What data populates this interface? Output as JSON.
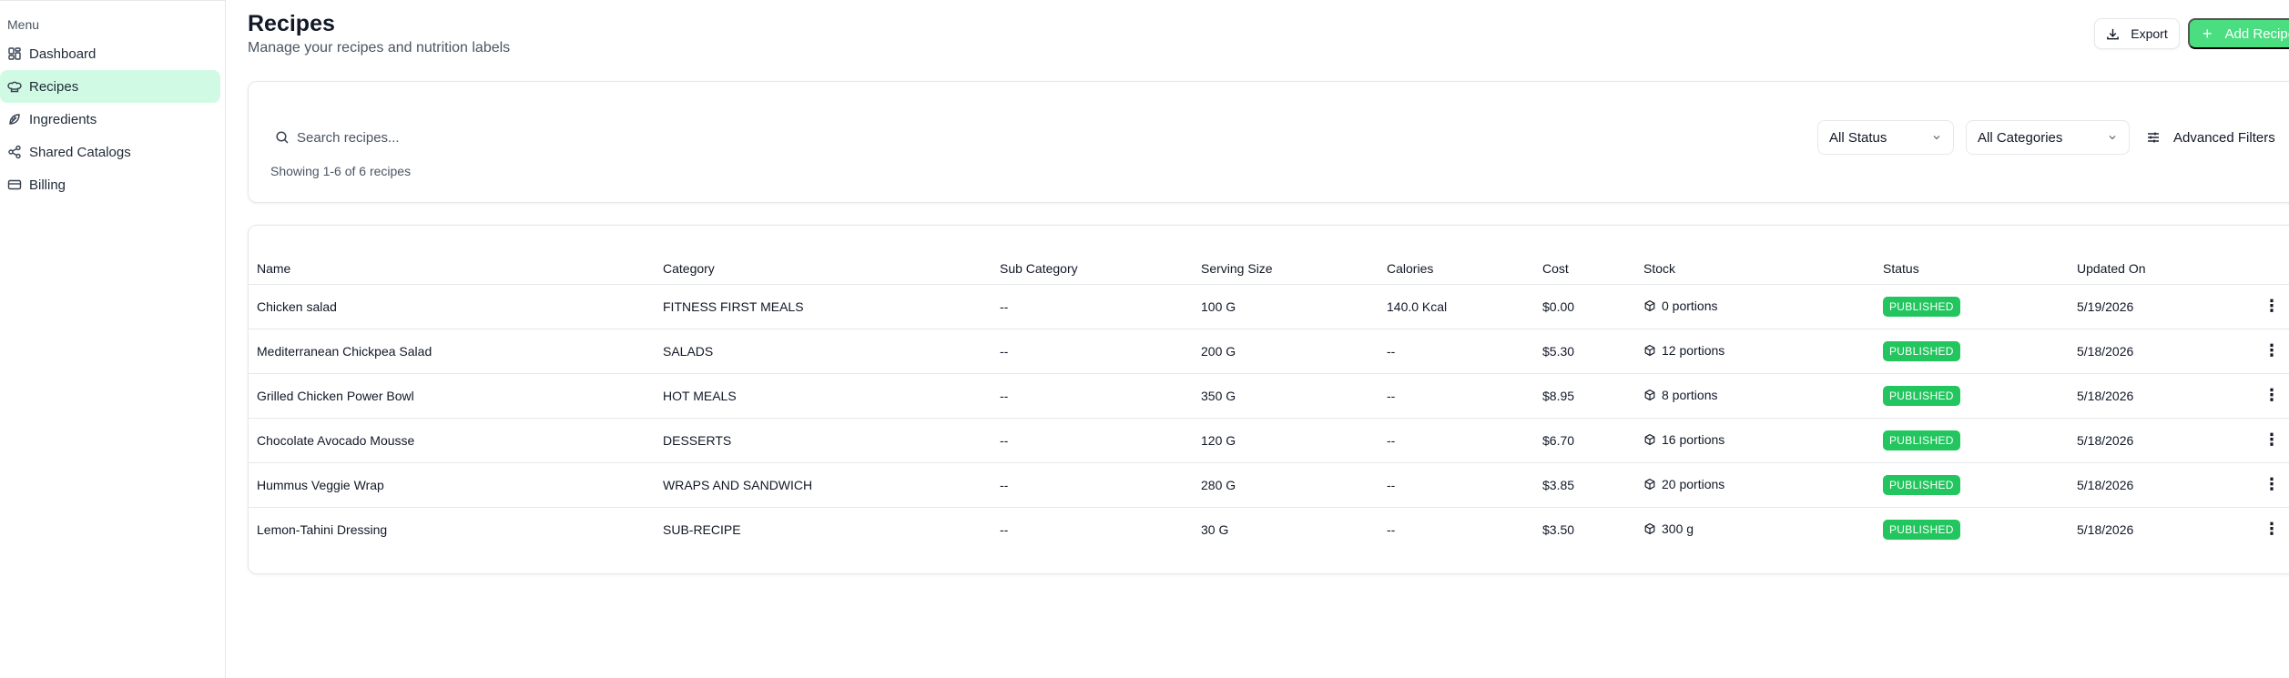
{
  "sidebar": {
    "menu_label": "Menu",
    "items": [
      {
        "label": "Dashboard",
        "icon": "dashboard-icon"
      },
      {
        "label": "Recipes",
        "icon": "chef-hat-icon",
        "active": true
      },
      {
        "label": "Ingredients",
        "icon": "leaf-icon"
      },
      {
        "label": "Shared Catalogs",
        "icon": "share-icon"
      },
      {
        "label": "Billing",
        "icon": "credit-card-icon"
      }
    ]
  },
  "header": {
    "title": "Recipes",
    "subtitle": "Manage your recipes and nutrition labels",
    "export_label": "Export",
    "add_label": "Add Recipe"
  },
  "filters": {
    "search_placeholder": "Search recipes...",
    "status_value": "All Status",
    "category_value": "All Categories",
    "advanced_label": "Advanced Filters",
    "showing_text": "Showing 1-6 of 6 recipes"
  },
  "table": {
    "columns": [
      "Name",
      "Category",
      "Sub Category",
      "Serving Size",
      "Calories",
      "Cost",
      "Stock",
      "Status",
      "Updated On"
    ],
    "rows": [
      {
        "name": "Chicken salad",
        "category": "FITNESS FIRST MEALS",
        "sub_category": "--",
        "serving": "100 G",
        "calories": "140.0 Kcal",
        "cost": "$0.00",
        "stock": "0 portions",
        "status": "PUBLISHED",
        "updated": "5/19/2026"
      },
      {
        "name": "Mediterranean Chickpea Salad",
        "category": "SALADS",
        "sub_category": "--",
        "serving": "200 G",
        "calories": "--",
        "cost": "$5.30",
        "stock": "12 portions",
        "status": "PUBLISHED",
        "updated": "5/18/2026"
      },
      {
        "name": "Grilled Chicken Power Bowl",
        "category": "HOT MEALS",
        "sub_category": "--",
        "serving": "350 G",
        "calories": "--",
        "cost": "$8.95",
        "stock": "8 portions",
        "status": "PUBLISHED",
        "updated": "5/18/2026"
      },
      {
        "name": "Chocolate Avocado Mousse",
        "category": "DESSERTS",
        "sub_category": "--",
        "serving": "120 G",
        "calories": "--",
        "cost": "$6.70",
        "stock": "16 portions",
        "status": "PUBLISHED",
        "updated": "5/18/2026"
      },
      {
        "name": "Hummus Veggie Wrap",
        "category": "WRAPS AND SANDWICH",
        "sub_category": "--",
        "serving": "280 G",
        "calories": "--",
        "cost": "$3.85",
        "stock": "20 portions",
        "status": "PUBLISHED",
        "updated": "5/18/2026"
      },
      {
        "name": "Lemon-Tahini Dressing",
        "category": "SUB-RECIPE",
        "sub_category": "--",
        "serving": "30 G",
        "calories": "--",
        "cost": "$3.50",
        "stock": "300 g",
        "status": "PUBLISHED",
        "updated": "5/18/2026"
      }
    ]
  },
  "colors": {
    "accent": "#4ade80",
    "active_nav_bg": "#d1fae5",
    "badge": "#22c55e"
  }
}
